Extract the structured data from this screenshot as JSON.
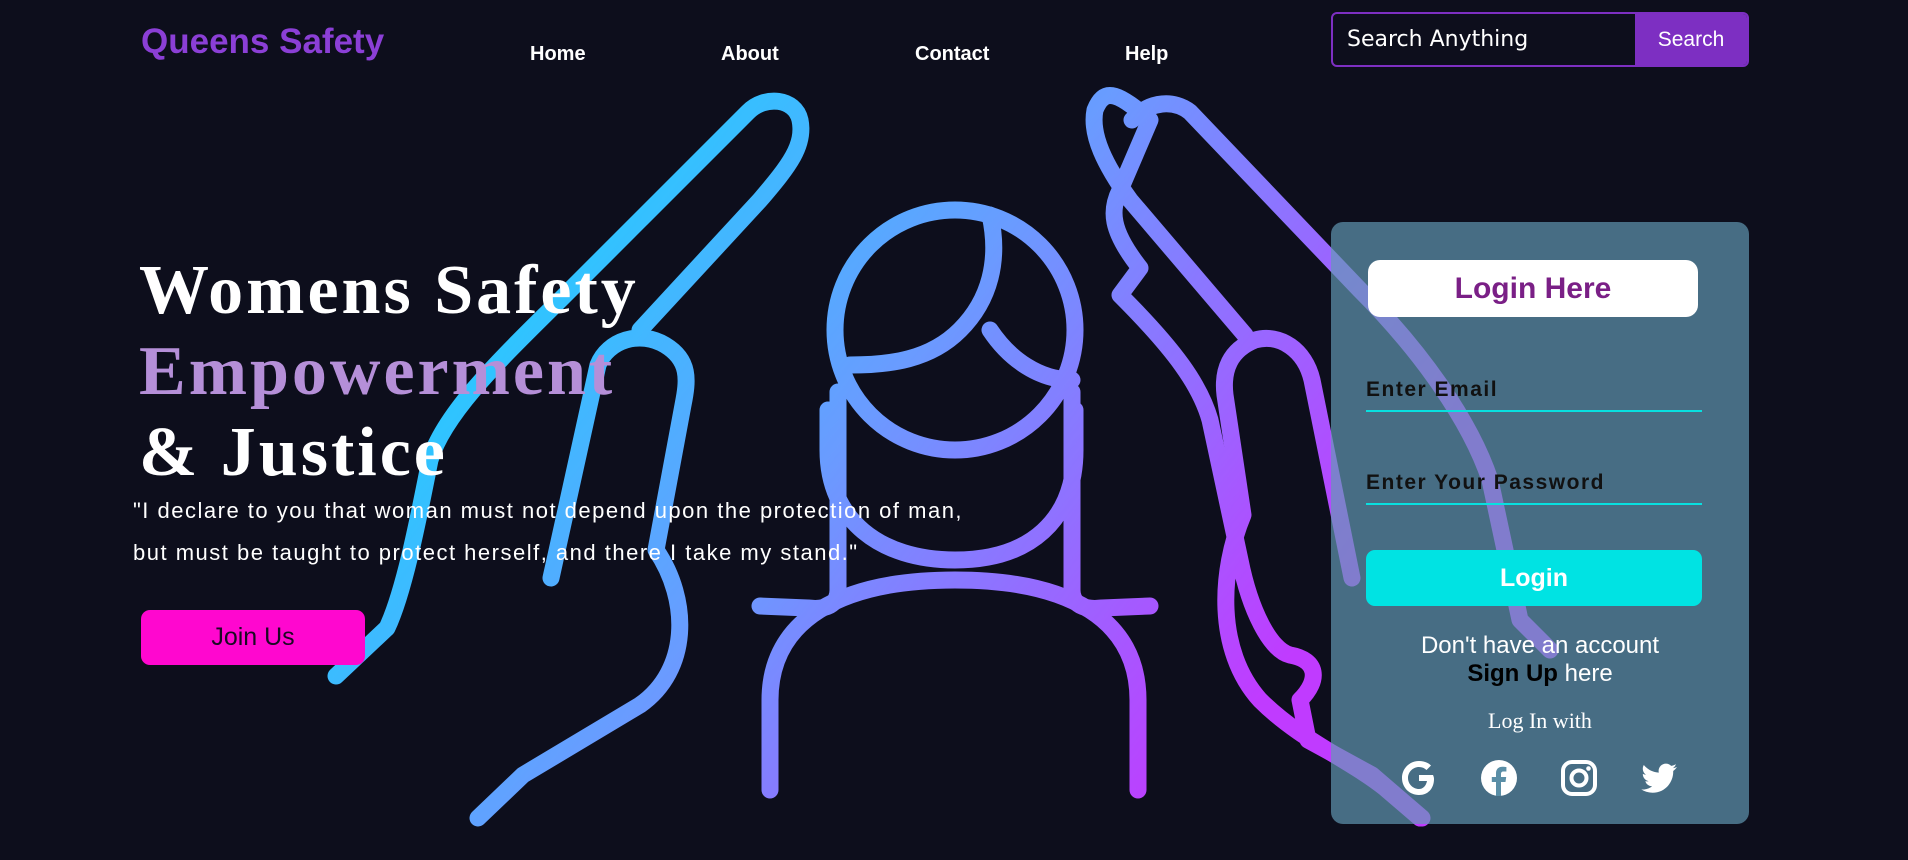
{
  "brand": {
    "logo_text": "Queens Safety"
  },
  "nav": {
    "items": [
      {
        "label": "Home"
      },
      {
        "label": "About"
      },
      {
        "label": "Contact"
      },
      {
        "label": "Help"
      }
    ]
  },
  "search": {
    "placeholder": "Search Anything",
    "button_label": "Search"
  },
  "hero": {
    "title_line1": "Womens Safety",
    "title_line2": "Empowerment",
    "title_line3": "& Justice",
    "quote_line1": "\"I declare to you that woman must not depend upon the protection of man,",
    "quote_line2": "but must be taught to protect herself, and there I take my stand.\"",
    "join_label": "Join Us"
  },
  "login": {
    "header": "Login Here",
    "email_placeholder": "Enter Email",
    "password_placeholder": "Enter Your Password",
    "button_label": "Login",
    "no_account_text": "Don't have an account",
    "signup_link": "Sign Up",
    "signup_suffix": " here",
    "login_with": "Log In with",
    "social_icons": [
      "google-icon",
      "facebook-icon",
      "instagram-icon",
      "twitter-icon"
    ]
  },
  "colors": {
    "background": "#0d0e1c",
    "brand_purple": "#8b3fd6",
    "accent_pink": "#ff07cf",
    "accent_cyan": "#00e3e3",
    "title_lavender": "#b58fd8",
    "panel": "#5a8ea6"
  }
}
